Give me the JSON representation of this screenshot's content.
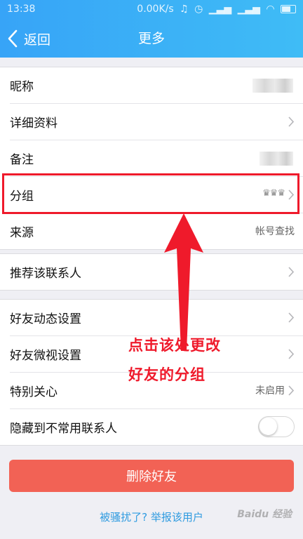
{
  "status_bar": {
    "time": "13:38",
    "network_speed": "0.00K/s",
    "icons": [
      "mute-icon",
      "alarm-icon",
      "signal-icon",
      "signal-icon",
      "wifi-icon",
      "battery-icon"
    ]
  },
  "nav": {
    "back_label": "返回",
    "title": "更多"
  },
  "group1": {
    "items": [
      {
        "label": "昵称",
        "value": ""
      },
      {
        "label": "详细资料",
        "value": ""
      },
      {
        "label": "备注",
        "value": ""
      },
      {
        "label": "分组",
        "value": "♛♛♛"
      },
      {
        "label": "来源",
        "value": "帐号查找"
      }
    ]
  },
  "group2": {
    "items": [
      {
        "label": "推荐该联系人"
      }
    ]
  },
  "group3": {
    "items": [
      {
        "label": "好友动态设置"
      },
      {
        "label": "好友微视设置"
      },
      {
        "label": "特别关心",
        "value": "未启用"
      },
      {
        "label": "隐藏到不常用联系人",
        "toggle_on": false
      }
    ]
  },
  "annotation": {
    "line1": "点击该处更改",
    "line2": "好友的分组",
    "color": "#ef1a2b"
  },
  "actions": {
    "delete_label": "删除好友",
    "report_label": "被骚扰了? 举报该用户"
  },
  "watermark": "Baidu 经验",
  "colors": {
    "header_start": "#37a4f7",
    "header_end": "#3fbcf6",
    "delete_button": "#f26255",
    "link": "#2f9be0"
  }
}
